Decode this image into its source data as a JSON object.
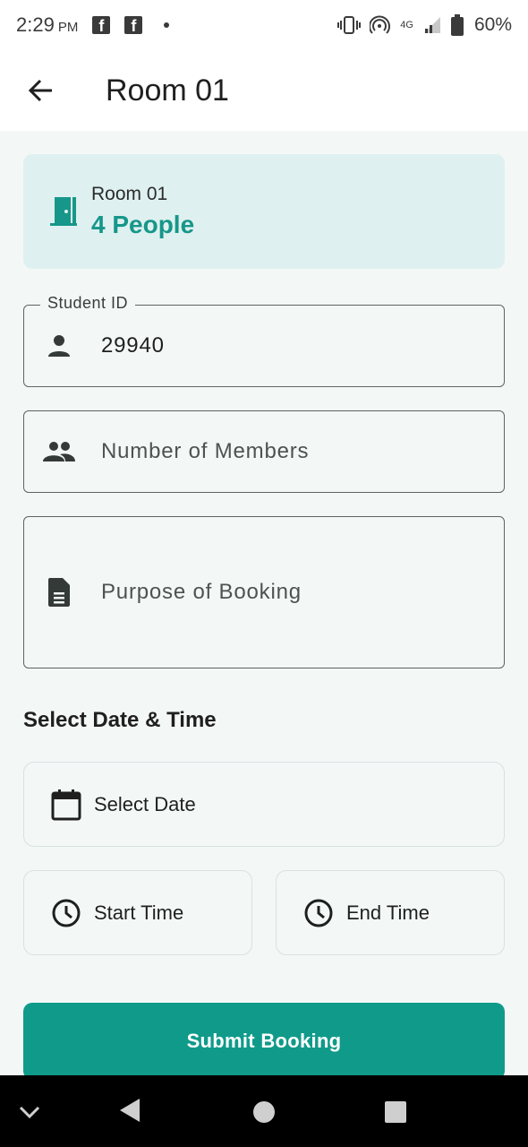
{
  "status_bar": {
    "time": "2:29",
    "ampm": "PM",
    "network": "4G",
    "battery": "60%"
  },
  "app_bar": {
    "title": "Room 01"
  },
  "room_card": {
    "name": "Room 01",
    "people": "4 People"
  },
  "form": {
    "student_id": {
      "label": "Student ID",
      "value": "29940"
    },
    "members": {
      "placeholder": "Number of Members"
    },
    "purpose": {
      "placeholder": "Purpose of Booking"
    }
  },
  "schedule": {
    "title": "Select Date & Time",
    "date_label": "Select Date",
    "start_label": "Start Time",
    "end_label": "End Time"
  },
  "submit_label": "Submit Booking",
  "colors": {
    "accent": "#109a8a",
    "card_bg": "#dff0f0",
    "page_bg": "#f3f8f7"
  },
  "icons": [
    "back-arrow-icon",
    "door-icon",
    "person-icon",
    "group-icon",
    "document-icon",
    "calendar-icon",
    "clock-icon"
  ]
}
